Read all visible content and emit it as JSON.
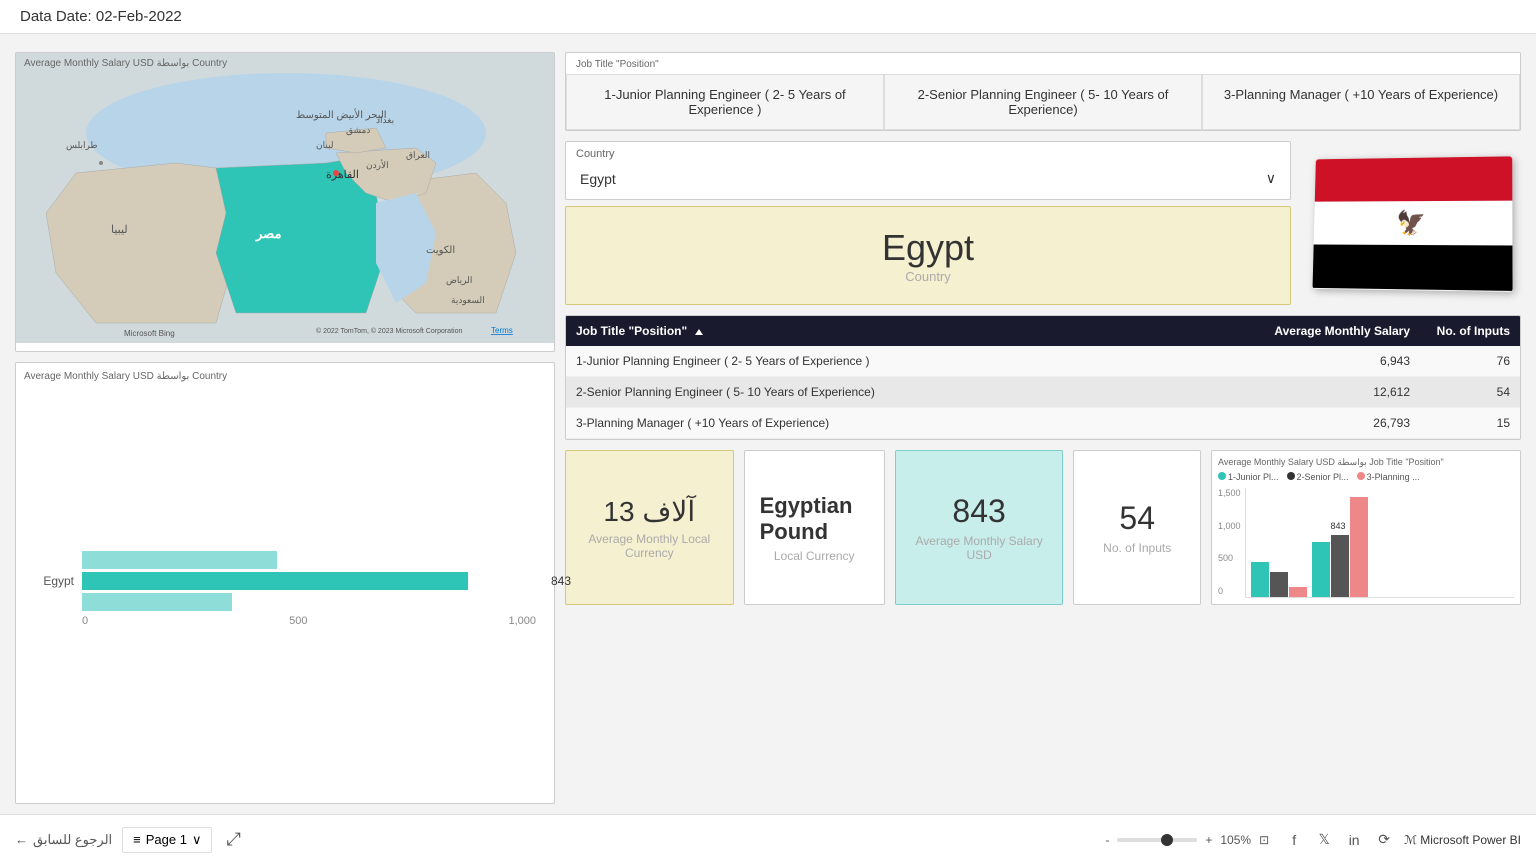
{
  "header": {
    "data_date_label": "Data Date: 02-Feb-2022"
  },
  "map": {
    "title": "Average Monthly Salary USD بواسطة Country",
    "bing_label": "Microsoft Bing",
    "terms_label": "Terms",
    "copyright": "© 2022 TomTom, © 2023 Microsoft Corporation"
  },
  "bar_chart": {
    "title": "Average Monthly Salary USD بواسطة Country",
    "country_label": "Egypt",
    "bar_value": "843",
    "x_axis": [
      "0",
      "500",
      "1,000"
    ]
  },
  "job_tabs": {
    "label": "Job Title \"Position\"",
    "tabs": [
      "1-Junior Planning Engineer ( 2- 5 Years of Experience )",
      "2-Senior Planning Engineer ( 5- 10 Years of Experience)",
      "3-Planning Manager ( +10 Years of Experience)"
    ]
  },
  "country_filter": {
    "label": "Country",
    "value": "Egypt",
    "chevron": "∨"
  },
  "country_display": {
    "name": "Egypt",
    "sub": "Country"
  },
  "table": {
    "headers": {
      "job_title": "Job Title \"Position\"",
      "avg_salary": "Average Monthly Salary",
      "no_inputs": "No. of Inputs"
    },
    "rows": [
      {
        "job": "1-Junior Planning Engineer ( 2- 5 Years of Experience )",
        "salary": "6,943",
        "inputs": "76"
      },
      {
        "job": "2-Senior Planning Engineer ( 5- 10 Years of Experience)",
        "salary": "12,612",
        "inputs": "54"
      },
      {
        "job": "3-Planning Manager ( +10 Years of Experience)",
        "salary": "26,793",
        "inputs": "15"
      }
    ]
  },
  "kpi_currency": {
    "value": "آلاف 13",
    "label": "Average Monthly Local Currency"
  },
  "kpi_local": {
    "value": "Egyptian Pound",
    "label": "Local Currency"
  },
  "kpi_salary_usd": {
    "value": "843",
    "label": "Average Monthly Salary USD"
  },
  "kpi_inputs": {
    "value": "54",
    "label": "No. of Inputs"
  },
  "mini_chart": {
    "title": "Average Monthly Salary USD بواسطة Job Title \"Position\"",
    "legend": [
      {
        "label": "1-Junior Pl...",
        "color": "#2ec4b6"
      },
      {
        "label": "2-Senior Pl...",
        "color": "#333"
      },
      {
        "label": "3-Planning ...",
        "color": "#e88"
      }
    ],
    "bar_843_label": "843",
    "y_labels": [
      "1,500",
      "1,000",
      "500",
      "0"
    ]
  },
  "nav": {
    "back_label": "الرجوع للسابق",
    "page_label": "Page 1",
    "zoom_percent": "105%"
  },
  "footer": {
    "powerbi": "ℳ Microsoft Power BI"
  }
}
